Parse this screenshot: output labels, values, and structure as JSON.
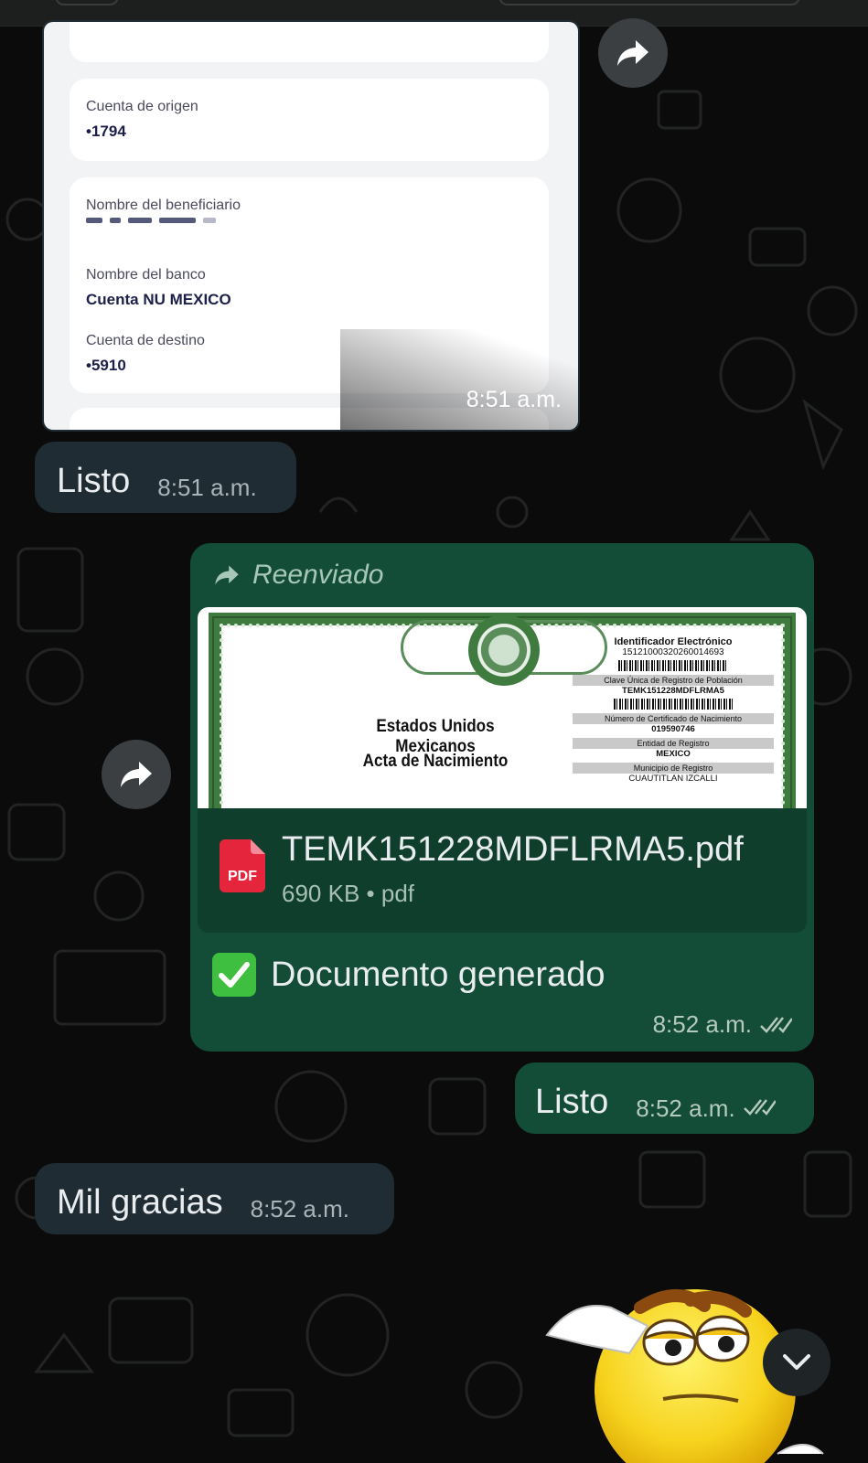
{
  "colors": {
    "incoming_bubble": "#202c33",
    "outgoing_bubble": "#134d37",
    "background": "#0b0b0b",
    "forwarded_label": "#a7c7b9"
  },
  "screenshot_message": {
    "cards": [
      {
        "label": "Cuenta de origen",
        "value": "•1794"
      },
      {
        "label": "Nombre del beneficiario",
        "value": ""
      },
      {
        "label": "Nombre del banco",
        "value": "Cuenta NU MEXICO"
      },
      {
        "label": "Cuenta de destino",
        "value": "•5910"
      }
    ],
    "time": "8:51 a.m."
  },
  "messages": [
    {
      "id": "m1",
      "direction": "in",
      "text": "Listo",
      "time": "8:51 a.m."
    },
    {
      "id": "m3",
      "direction": "out",
      "text": "Listo",
      "time": "8:52 a.m.",
      "status": "read"
    },
    {
      "id": "m4",
      "direction": "in",
      "text": "Mil gracias",
      "time": "8:52 a.m."
    }
  ],
  "document_message": {
    "forwarded_label": "Reenviado",
    "preview": {
      "left_title_1": "Estados Unidos Mexicanos",
      "left_title_2": "Acta de Nacimiento",
      "id_heading": "Identificador Electrónico",
      "id_number": "15121000320260014693",
      "curp_heading": "Clave Única de Registro de Población",
      "curp_value": "TEMK151228MDFLRMA5",
      "cert_heading": "Número de Certificado de Nacimiento",
      "cert_value": "019590746",
      "entidad_heading": "Entidad de Registro",
      "entidad_value": "MEXICO",
      "municipio_heading": "Municipio de Registro",
      "municipio_value": "CUAUTITLAN IZCALLI"
    },
    "file_icon_label": "PDF",
    "file_name": "TEMK151228MDFLRMA5.pdf",
    "file_size": "690 KB",
    "file_type": "pdf",
    "caption": "Documento generado",
    "caption_emoji": "white-check-mark",
    "time": "8:52 a.m.",
    "status": "read"
  },
  "icons": {
    "forward_button": "forward-arrow-icon",
    "scroll_down": "chevron-down-icon",
    "sticker": "saluting-emoji-sticker"
  }
}
